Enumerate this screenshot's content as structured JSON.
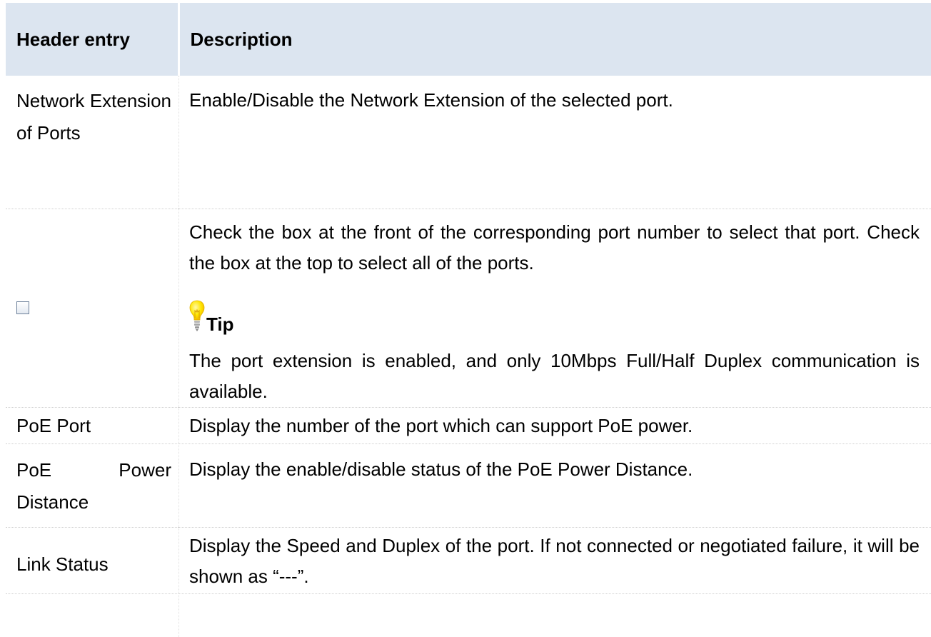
{
  "table": {
    "header": {
      "col1": "Header entry",
      "col2": "Description"
    },
    "rows": [
      {
        "entry": "Network Extension of Ports",
        "description": "Enable/Disable the Network Extension of the selected port."
      },
      {
        "entry_icon": "checkbox-icon",
        "description": "Check the box at the front of the corresponding port number to select that port. Check the box at the top to select all of the ports.",
        "tip": {
          "icon": "lightbulb-icon",
          "label": "Tip",
          "text": "The port extension is enabled, and only 10Mbps Full/Half Duplex communication is available."
        }
      },
      {
        "entry": "PoE Port",
        "description": "Display the number of the port which can support PoE power."
      },
      {
        "entry": "PoE Power Distance",
        "description": "Display the enable/disable status of the PoE Power Distance."
      },
      {
        "entry": "Link Status",
        "description": "Display the Speed and Duplex of the port. If not connected or negotiated failure, it will be shown as “---”."
      }
    ]
  },
  "colors": {
    "header_background": "#dce5f0",
    "bulb_yellow": "#ffe600"
  }
}
